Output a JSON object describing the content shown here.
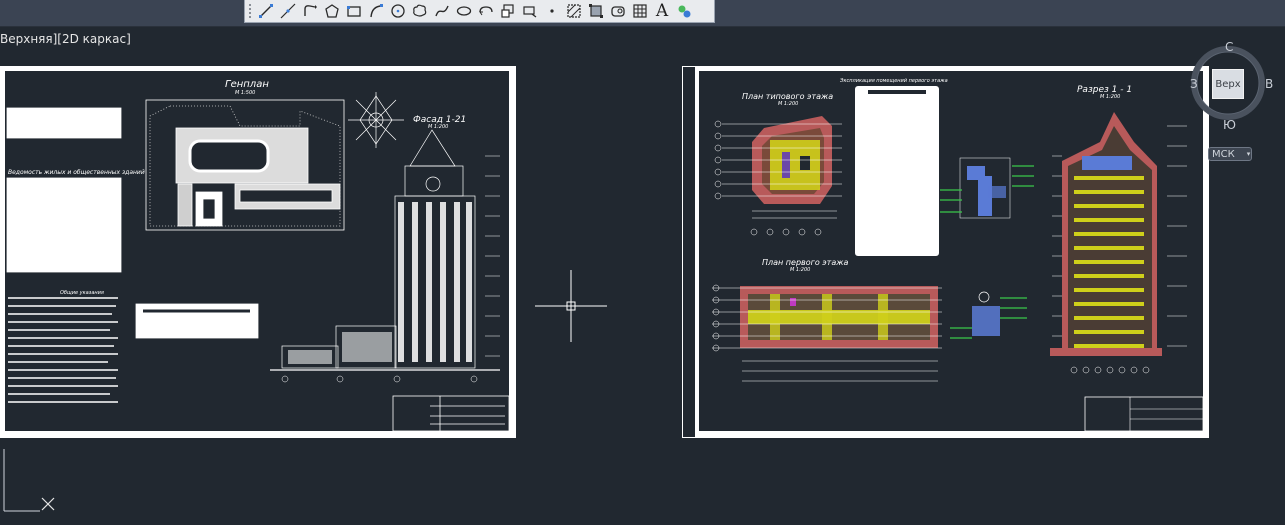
{
  "toolbar": {
    "tools": [
      "line-icon",
      "construction-line-icon",
      "polyline-icon",
      "polygon-icon",
      "rectangle-icon",
      "arc-icon",
      "circle-icon",
      "revision-cloud-icon",
      "spline-icon",
      "ellipse-icon",
      "ellipse-arc-icon",
      "insert-block-icon",
      "make-block-icon",
      "point-icon",
      "hatch-icon",
      "gradient-icon",
      "region-icon",
      "table-icon",
      "multiline-text-icon",
      "add-selected-icon"
    ],
    "text_tool_glyph": "A"
  },
  "viewport": {
    "label": "Верхняя][2D каркас]"
  },
  "viewcube": {
    "north": "С",
    "south": "Ю",
    "west": "З",
    "east": "В",
    "face": "Верх",
    "ucs_label": "МСК"
  },
  "drawing": {
    "sheet1": {
      "genplan_title": "Генплан",
      "genplan_scale": "М 1:500",
      "facade_title": "Фасад 1-21",
      "facade_scale": "М 1:200",
      "statement_title": "Ведомость жилых и общественных зданий",
      "notes_title": "Общие указания"
    },
    "sheet2": {
      "typical_floor_title": "План типового этажа",
      "typical_floor_scale": "М 1:200",
      "first_floor_title": "План первого этажа",
      "first_floor_scale": "М 1:200",
      "section_title": "Разрез 1 - 1",
      "section_scale": "М 1:200",
      "explication_title": "Экспликация помещений первого этажа"
    }
  },
  "colors": {
    "background": "#212830",
    "sheet": "#ffffff",
    "walls": "#b85a5a",
    "hatch": "#d8d11a",
    "blue": "#5a7bd6",
    "green": "#39c84a"
  }
}
